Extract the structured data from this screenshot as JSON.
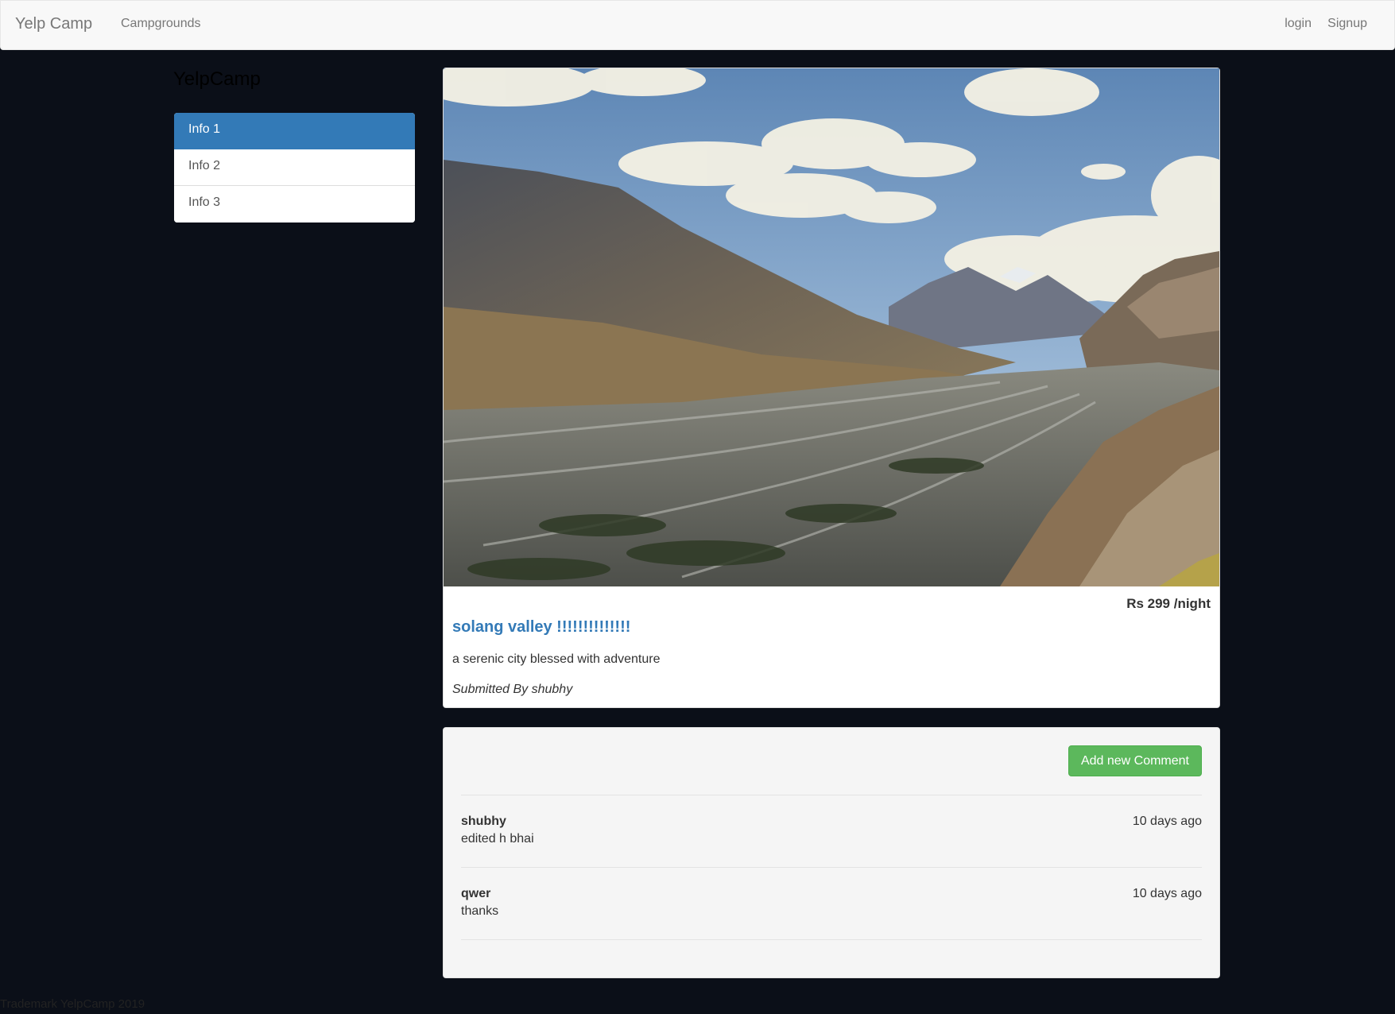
{
  "navbar": {
    "brand": "Yelp Camp",
    "links": [
      "Campgrounds"
    ],
    "right_links": [
      "login",
      "Signup"
    ]
  },
  "sidebar": {
    "heading": "YelpCamp",
    "items": [
      {
        "label": "Info 1",
        "active": true
      },
      {
        "label": "Info 2",
        "active": false
      },
      {
        "label": "Info 3",
        "active": false
      }
    ]
  },
  "campground": {
    "image_alt": "mountain valley landscape",
    "price": "Rs 299 /night",
    "name": "solang valley !!!!!!!!!!!!!!",
    "description": "a serenic city blessed with adventure",
    "submitted_by": "Submitted By shubhy"
  },
  "comments": {
    "add_button_label": "Add new Comment",
    "items": [
      {
        "author": "shubhy",
        "time": "10 days ago",
        "text": "edited h bhai"
      },
      {
        "author": "qwer",
        "time": "10 days ago",
        "text": "thanks"
      }
    ]
  },
  "footer": {
    "text": "Trademark YelpCamp 2019"
  },
  "colors": {
    "background": "#0b0f18",
    "primary": "#337ab7",
    "success": "#5cb85c"
  }
}
